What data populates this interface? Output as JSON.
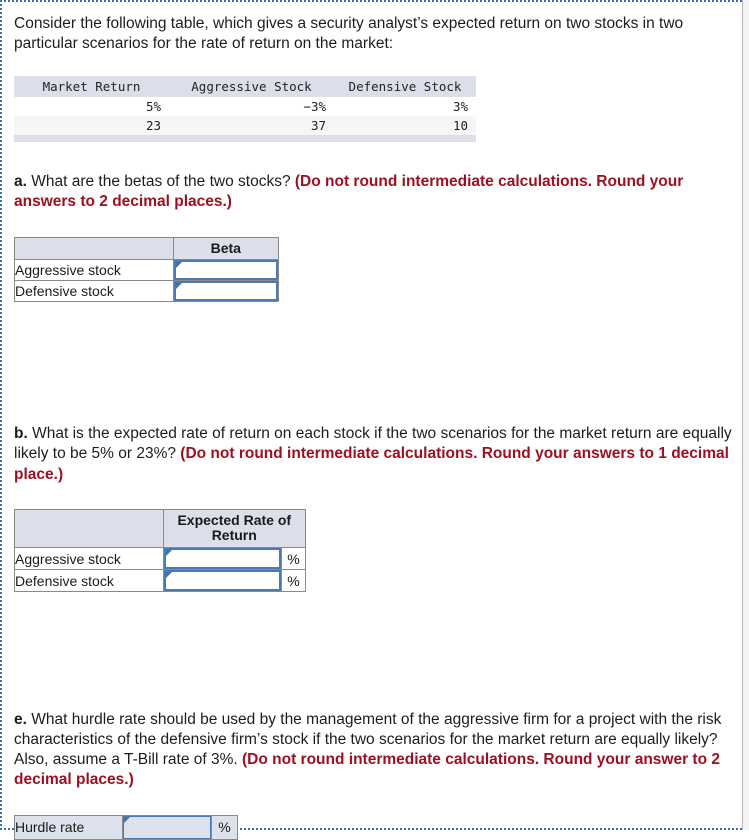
{
  "intro": {
    "text": "Consider the following table, which gives a security analyst’s expected return on two stocks in two particular scenarios for the rate of return on the market:"
  },
  "scenario_table": {
    "headers": [
      "Market Return",
      "Aggressive Stock",
      "Defensive Stock"
    ],
    "rows": [
      [
        "5%",
        "−3%",
        "3%"
      ],
      [
        "23",
        "37",
        "10"
      ]
    ]
  },
  "parts": {
    "a": {
      "letter": "a.",
      "question": " What are the betas of the two stocks? ",
      "instruction": "(Do not round intermediate calculations. Round your answers to 2 decimal places.)",
      "table": {
        "blank_header": "",
        "col_header": "Beta",
        "rows": [
          {
            "label": "Aggressive stock",
            "value": ""
          },
          {
            "label": "Defensive stock",
            "value": ""
          }
        ]
      }
    },
    "b": {
      "letter": "b.",
      "question": " What is the expected rate of return on each stock if the two scenarios for the market return are equally likely to be 5% or 23%? ",
      "instruction": "(Do not round intermediate calculations. Round your answers to 1 decimal place.)",
      "table": {
        "blank_header": "",
        "col_header": "Expected Rate of Return",
        "rows": [
          {
            "label": "Aggressive stock",
            "value": "",
            "unit": "%"
          },
          {
            "label": "Defensive stock",
            "value": "",
            "unit": "%"
          }
        ]
      }
    },
    "e": {
      "letter": "e.",
      "question": " What hurdle rate should be used by the management of the aggressive firm for a project with the risk characteristics of the defensive firm’s stock if the two scenarios for the market return are equally likely? Also, assume a T-Bill rate of 3%. ",
      "instruction": "(Do not round intermediate calculations. Round your answer to 2 decimal places.)",
      "table": {
        "rows": [
          {
            "label": "Hurdle rate",
            "value": "",
            "unit": "%"
          }
        ]
      }
    }
  },
  "colors": {
    "header_fill": "#dcdfea",
    "instruction_red": "#9e1021",
    "input_border_blue": "#4a7ab5",
    "frame_dotted_blue": "#3a6fb0",
    "tinted_row": "#dde1eb"
  }
}
